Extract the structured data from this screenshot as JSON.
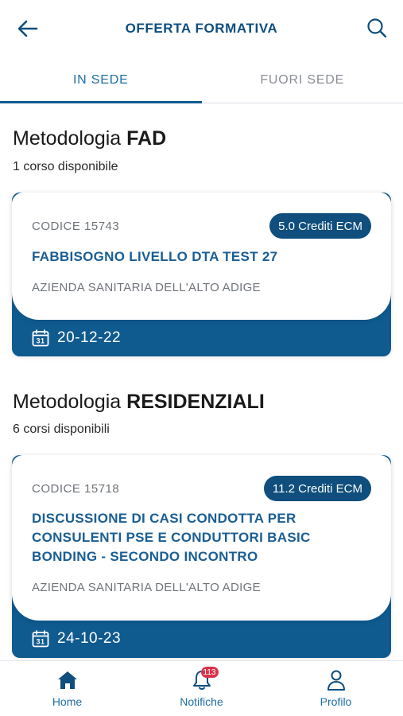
{
  "header": {
    "title": "OFFERTA FORMATIVA",
    "back_icon": "arrow-left-icon",
    "search_icon": "search-icon"
  },
  "tabs": [
    {
      "label": "IN SEDE",
      "active": true
    },
    {
      "label": "FUORI SEDE",
      "active": false
    }
  ],
  "sections": [
    {
      "title_prefix": "Metodologia ",
      "title_bold": "FAD",
      "subtitle": "1 corso disponibile",
      "courses": [
        {
          "code": "CODICE 15743",
          "credits": "5.0 Crediti ECM",
          "title": "FABBISOGNO LIVELLO DTA TEST 27",
          "organization": "AZIENDA SANITARIA DELL'ALTO ADIGE",
          "date": "20-12-22"
        }
      ]
    },
    {
      "title_prefix": "Metodologia ",
      "title_bold": "RESIDENZIALI",
      "subtitle": "6 corsi disponibili",
      "courses": [
        {
          "code": "CODICE 15718",
          "credits": "11.2 Crediti ECM",
          "title": "DISCUSSIONE DI CASI CONDOTTA PER CONSULENTI PSE E CONDUTTORI BASIC BONDING - SECONDO INCONTRO",
          "organization": "AZIENDA SANITARIA DELL'ALTO ADIGE",
          "date": "24-10-23"
        }
      ]
    }
  ],
  "bottom_nav": {
    "items": [
      {
        "label": "Home",
        "icon": "home-icon"
      },
      {
        "label": "Notifiche",
        "icon": "bell-icon",
        "badge": "113"
      },
      {
        "label": "Profilo",
        "icon": "user-icon"
      }
    ]
  },
  "colors": {
    "primary": "#0f4e7d",
    "accent": "#1d6ea6",
    "card_footer": "#0f5a8f",
    "badge_red": "#d9334a"
  }
}
